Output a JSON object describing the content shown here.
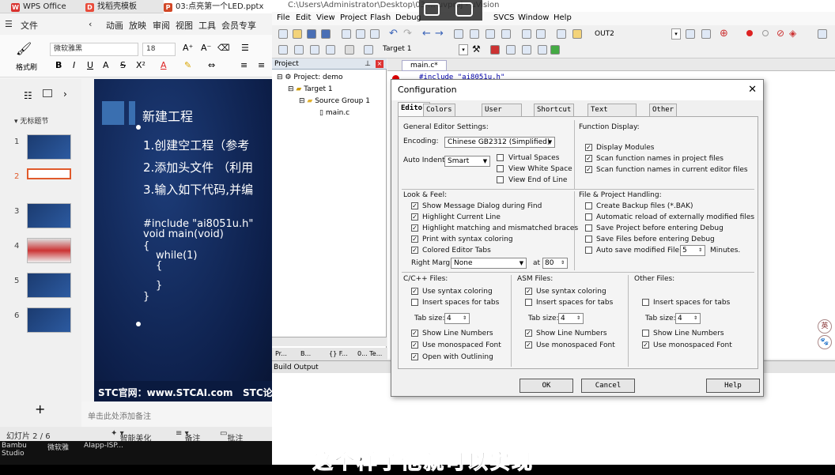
{
  "wps": {
    "tabs": [
      "WPS Office",
      "找稻壳模板",
      "03:点亮第一个LED.pptx"
    ],
    "menu": [
      "文件",
      "动画",
      "放映",
      "审阅",
      "视图",
      "工具",
      "会员专享"
    ],
    "font_name": "微软雅黑",
    "font_size": "18",
    "format_painter": "格式刷",
    "section": "无标题节",
    "slide_numbers": [
      "1",
      "2",
      "3",
      "4",
      "5",
      "6"
    ],
    "slide": {
      "title": "新建工程",
      "line1": "1.创建空工程（参考",
      "line2": "2.添加头文件 （利用",
      "line3": "3.输入如下代码,并编",
      "code": [
        "#include \"ai8051u.h\"",
        "void main(void)",
        "{",
        "while(1)",
        "{",
        "}",
        "}"
      ],
      "footer": "STC官网：www.STCAI.com",
      "footer2": "STC论"
    },
    "notes_placeholder": "单击此处添加备注",
    "status": {
      "slide_count": "幻灯片 2 / 6",
      "beautify": "智能美化",
      "notes": "备注",
      "comment": "批注"
    },
    "bottom_apps": [
      "Bambu Studio",
      "微软雅",
      "AIapp-ISP..."
    ]
  },
  "uvision": {
    "title": "C:\\Users\\Administrator\\Desktop\\03 ... uvproj - µVision",
    "menu": [
      "File",
      "Edit",
      "View",
      "Project",
      "Flash",
      "Debug",
      "SVCS",
      "Window",
      "Help"
    ],
    "target_combo": "Target 1",
    "toolbar_combo": "OUT2",
    "project_panel_title": "Project",
    "tree": [
      "Project: demo",
      "Target 1",
      "Source Group 1",
      "main.c"
    ],
    "panel_tabs": [
      "Pr...",
      "B...",
      "{} F...",
      "0... Te..."
    ],
    "editor_tab": "main.c*",
    "editor_line": "#include \"ai8051u.h\"",
    "build_output": "Build Output"
  },
  "dialog": {
    "title": "Configuration",
    "tabs": [
      "Editor",
      "Colors & Fonts",
      "User Keywords",
      "Shortcut Keys",
      "Text Completion",
      "Other"
    ],
    "general_title": "General Editor Settings:",
    "encoding_label": "Encoding:",
    "encoding_value": "Chinese GB2312 (Simplified)",
    "auto_indent_label": "Auto Indent:",
    "auto_indent_value": "Smart",
    "virtual_spaces": "Virtual Spaces",
    "view_white_space": "View White Space",
    "view_end_of_line": "View End of Line",
    "function_display_title": "Function Display:",
    "function_display": [
      "Display Modules",
      "Scan function names in project files",
      "Scan function names in current editor files"
    ],
    "look_feel_title": "Look & Feel:",
    "look_feel": [
      "Show Message Dialog during Find",
      "Highlight Current Line",
      "Highlight matching and mismatched braces",
      "Print with syntax coloring",
      "Colored Editor Tabs"
    ],
    "right_margin_label": "Right Margin:",
    "right_margin_value": "None",
    "at_label": "at",
    "at_value": "80",
    "file_handling_title": "File & Project Handling:",
    "file_handling": [
      "Create Backup files (*.BAK)",
      "Automatic reload of externally modified files",
      "Save Project before entering Debug",
      "Save Files before entering Debug",
      "Auto save modified File every"
    ],
    "auto_save_value": "5",
    "minutes": "Minutes.",
    "cpp_title": "C/C++ Files:",
    "asm_title": "ASM Files:",
    "other_title": "Other Files:",
    "use_syntax_coloring": "Use syntax coloring",
    "insert_spaces": "Insert spaces for tabs",
    "tab_size": "Tab size:",
    "tab_value": "4",
    "show_line_numbers": "Show Line Numbers",
    "use_monospaced": "Use monospaced Font",
    "open_outlining": "Open with Outlining",
    "ok": "OK",
    "cancel": "Cancel",
    "help": "Help"
  },
  "subtitle": "这个样子他就可以实现",
  "badges": [
    "英",
    "🐾"
  ]
}
